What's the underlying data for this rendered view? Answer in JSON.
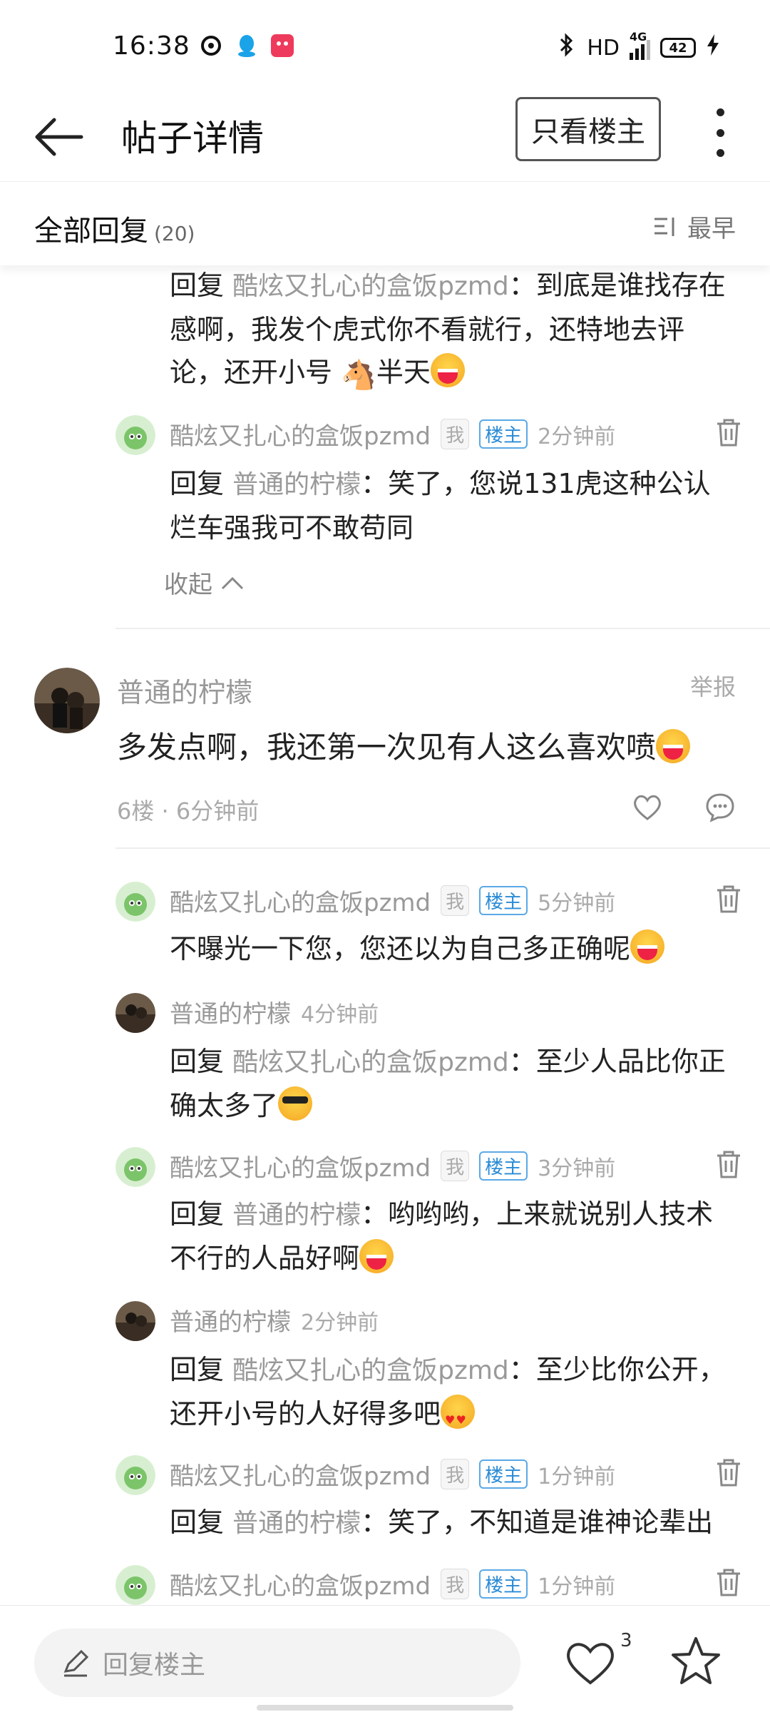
{
  "status_bar": {
    "time": "16:38",
    "hd": "HD",
    "signal": "4G",
    "battery": "42",
    "icons": [
      "netease-icon",
      "qq-icon",
      "app-red-icon",
      "bluetooth-icon",
      "signal-icon",
      "charging-icon"
    ]
  },
  "header": {
    "title": "帖子详情",
    "only_op_label": "只看楼主"
  },
  "replies_bar": {
    "label": "全部回复",
    "count": "(20)",
    "sort_label": "最早"
  },
  "thread_top": {
    "reply_prefix": "回复",
    "reply_to": "酷炫又扎心的盒饭pzmd",
    "text_a": "：到底是谁找存在",
    "text_b": "感啊，我发个虎式你不看就行，还特地去评",
    "text_c": "论，还开小号",
    "text_d": "半天"
  },
  "sub_reply_1": {
    "name": "酷炫又扎心的盒饭pzmd",
    "tag_me": "我",
    "tag_op": "楼主",
    "time": "2分钟前",
    "reply_prefix": "回复",
    "reply_to": "普通的柠檬",
    "text_a": "：笑了，您说131虎这种公认",
    "text_b": "烂车强我可不敢苟同"
  },
  "collapse_label": "收起",
  "floor6": {
    "name": "普通的柠檬",
    "report": "举报",
    "text": "多发点啊，我还第一次见有人这么喜欢喷",
    "meta": "6楼 · 6分钟前"
  },
  "floor6_replies": [
    {
      "name": "酷炫又扎心的盒饭pzmd",
      "tag_me": "我",
      "tag_op": "楼主",
      "time": "5分钟前",
      "text": "不曝光一下您，您还以为自己多正确呢"
    },
    {
      "name": "普通的柠檬",
      "time": "4分钟前",
      "reply_prefix": "回复",
      "reply_to": "酷炫又扎心的盒饭pzmd",
      "text_a": "：至少人品比你正",
      "text_b": "确太多了"
    },
    {
      "name": "酷炫又扎心的盒饭pzmd",
      "tag_me": "我",
      "tag_op": "楼主",
      "time": "3分钟前",
      "reply_prefix": "回复",
      "reply_to": "普通的柠檬",
      "text_a": "：哟哟哟，上来就说别人技术",
      "text_b": "不行的人品好啊"
    },
    {
      "name": "普通的柠檬",
      "time": "2分钟前",
      "reply_prefix": "回复",
      "reply_to": "酷炫又扎心的盒饭pzmd",
      "text_a": "：至少比你公开，",
      "text_b": "还开小号的人好得多吧"
    },
    {
      "name": "酷炫又扎心的盒饭pzmd",
      "tag_me": "我",
      "tag_op": "楼主",
      "time": "1分钟前",
      "reply_prefix": "回复",
      "reply_to": "普通的柠檬",
      "text_a": "：笑了，不知道是谁神论辈出"
    },
    {
      "name": "酷炫又扎心的盒饭pzmd",
      "tag_me": "我",
      "tag_op": "楼主",
      "time": "1分钟前"
    }
  ],
  "bottom_bar": {
    "reply_placeholder": "回复楼主",
    "like_count": "3"
  },
  "colors": {
    "accent_blue": "#2a8bd6",
    "name_gray": "#999999",
    "text_dark": "#222222"
  }
}
